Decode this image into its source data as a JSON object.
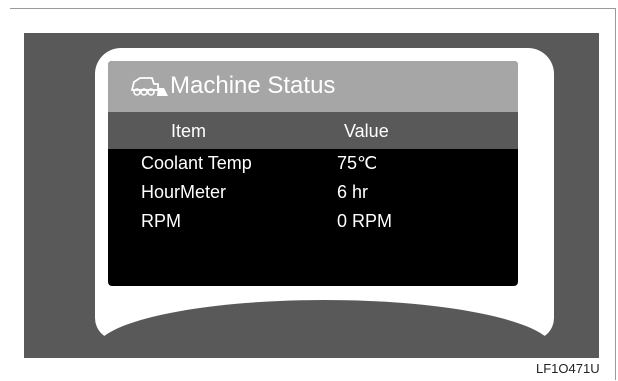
{
  "display": {
    "title": "Machine Status",
    "title_icon": "machine-icon",
    "columns": {
      "item": "Item",
      "value": "Value"
    },
    "rows": [
      {
        "item": "Coolant Temp",
        "value": "75℃"
      },
      {
        "item": "HourMeter",
        "value": "6 hr"
      },
      {
        "item": "RPM",
        "value": "0 RPM"
      }
    ]
  },
  "caption": "LF1O471U",
  "colors": {
    "bezel": "#595959",
    "title_bar": "#a6a6a6",
    "header_bar": "#595959",
    "screen_bg": "#000000",
    "text": "#ffffff"
  }
}
